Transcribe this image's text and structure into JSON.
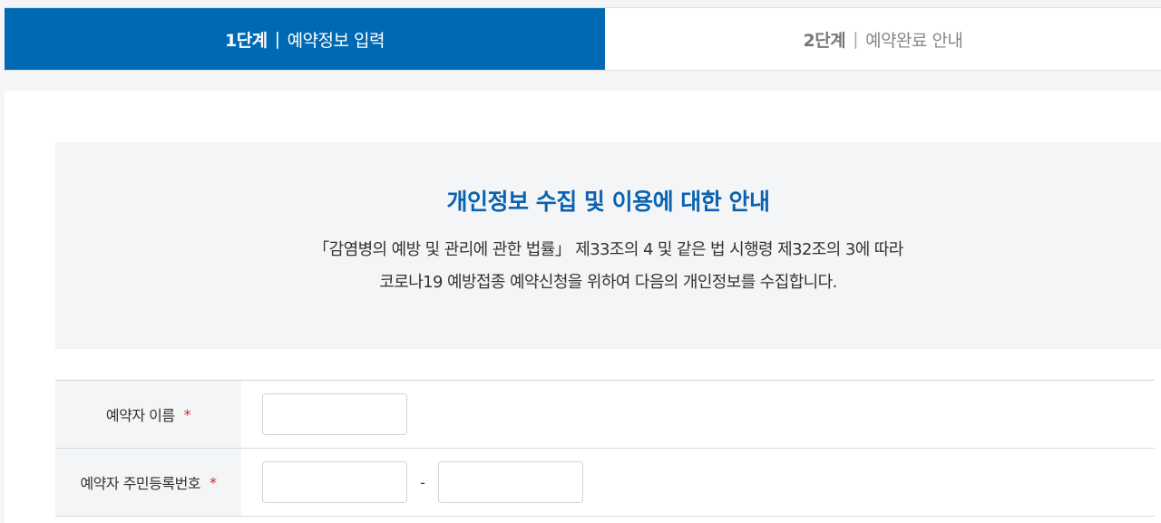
{
  "steps": [
    {
      "number": "1단계",
      "separator": "|",
      "label": "예약정보 입력",
      "active": true
    },
    {
      "number": "2단계",
      "separator": "|",
      "label": "예약완료 안내",
      "active": false
    }
  ],
  "notice": {
    "title": "개인정보 수집 및 이용에 대한 안내",
    "line1": "「감염병의 예방 및 관리에 관한 법률」 제33조의 4 및 같은 법 시행령 제32조의 3에 따라",
    "line2": "코로나19 예방접종 예약신청을 위하여 다음의 개인정보를 수집합니다."
  },
  "form": {
    "name": {
      "label": "예약자 이름",
      "required_mark": "*",
      "value": "",
      "placeholder": ""
    },
    "rrn": {
      "label": "예약자 주민등록번호",
      "required_mark": "*",
      "separator": "-",
      "front_value": "",
      "back_value": ""
    }
  },
  "colors": {
    "active_step": "#0069b4",
    "title": "#0a62b0",
    "required": "#d9262b"
  }
}
